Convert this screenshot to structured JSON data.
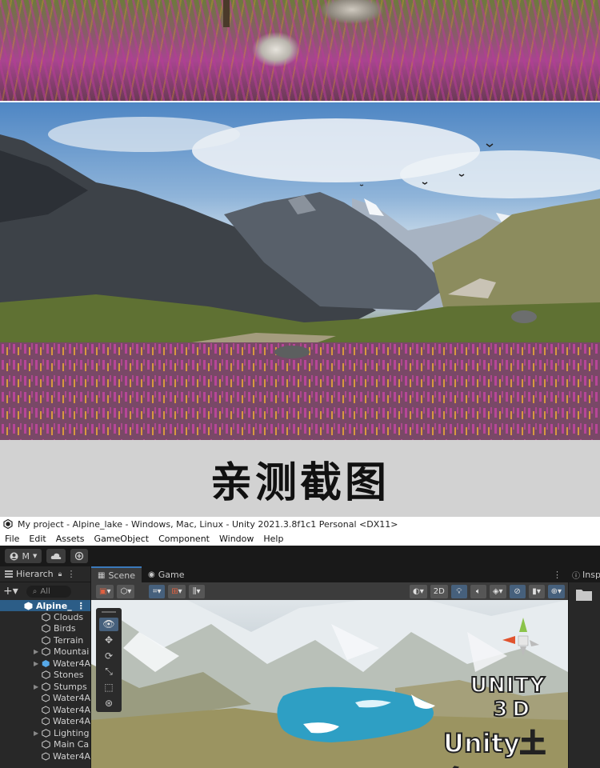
{
  "caption": "亲测截图",
  "editor": {
    "title": "My project - Alpine_lake - Windows, Mac, Linux - Unity 2021.3.8f1c1 Personal <DX11>",
    "menu": [
      "File",
      "Edit",
      "Assets",
      "GameObject",
      "Component",
      "Window",
      "Help"
    ],
    "toolbar": {
      "account_label": "M"
    },
    "hierarchy": {
      "tab_label": "Hierarch",
      "search_placeholder": "All",
      "scene_name": "Alpine_",
      "items": [
        {
          "label": "Clouds",
          "expandable": false,
          "icon": "cube-icon"
        },
        {
          "label": "Birds",
          "expandable": false,
          "icon": "cube-icon"
        },
        {
          "label": "Terrain",
          "expandable": false,
          "icon": "cube-icon"
        },
        {
          "label": "Mountai",
          "expandable": true,
          "icon": "cube-icon"
        },
        {
          "label": "Water4A",
          "expandable": true,
          "icon": "prefab-cube-icon"
        },
        {
          "label": "Stones",
          "expandable": false,
          "icon": "cube-icon"
        },
        {
          "label": "Stumps",
          "expandable": true,
          "icon": "cube-icon"
        },
        {
          "label": "Water4A",
          "expandable": false,
          "icon": "cube-icon"
        },
        {
          "label": "Water4A",
          "expandable": false,
          "icon": "cube-icon"
        },
        {
          "label": "Water4A",
          "expandable": false,
          "icon": "cube-icon"
        },
        {
          "label": "Lighting",
          "expandable": true,
          "icon": "cube-icon"
        },
        {
          "label": "Main Ca",
          "expandable": false,
          "icon": "cube-icon"
        },
        {
          "label": "Water4A",
          "expandable": false,
          "icon": "cube-icon"
        }
      ]
    },
    "scene": {
      "tabs": [
        "Scene",
        "Game"
      ],
      "mode_2d_label": "2D"
    },
    "inspector": {
      "tab_label": "Insp"
    },
    "watermark": {
      "line1": "UNITY",
      "line2": "3D",
      "line3": "Unity土多"
    },
    "colors": {
      "selection": "#2c5d87",
      "accent": "#3a79bb",
      "panel": "#282828"
    }
  }
}
